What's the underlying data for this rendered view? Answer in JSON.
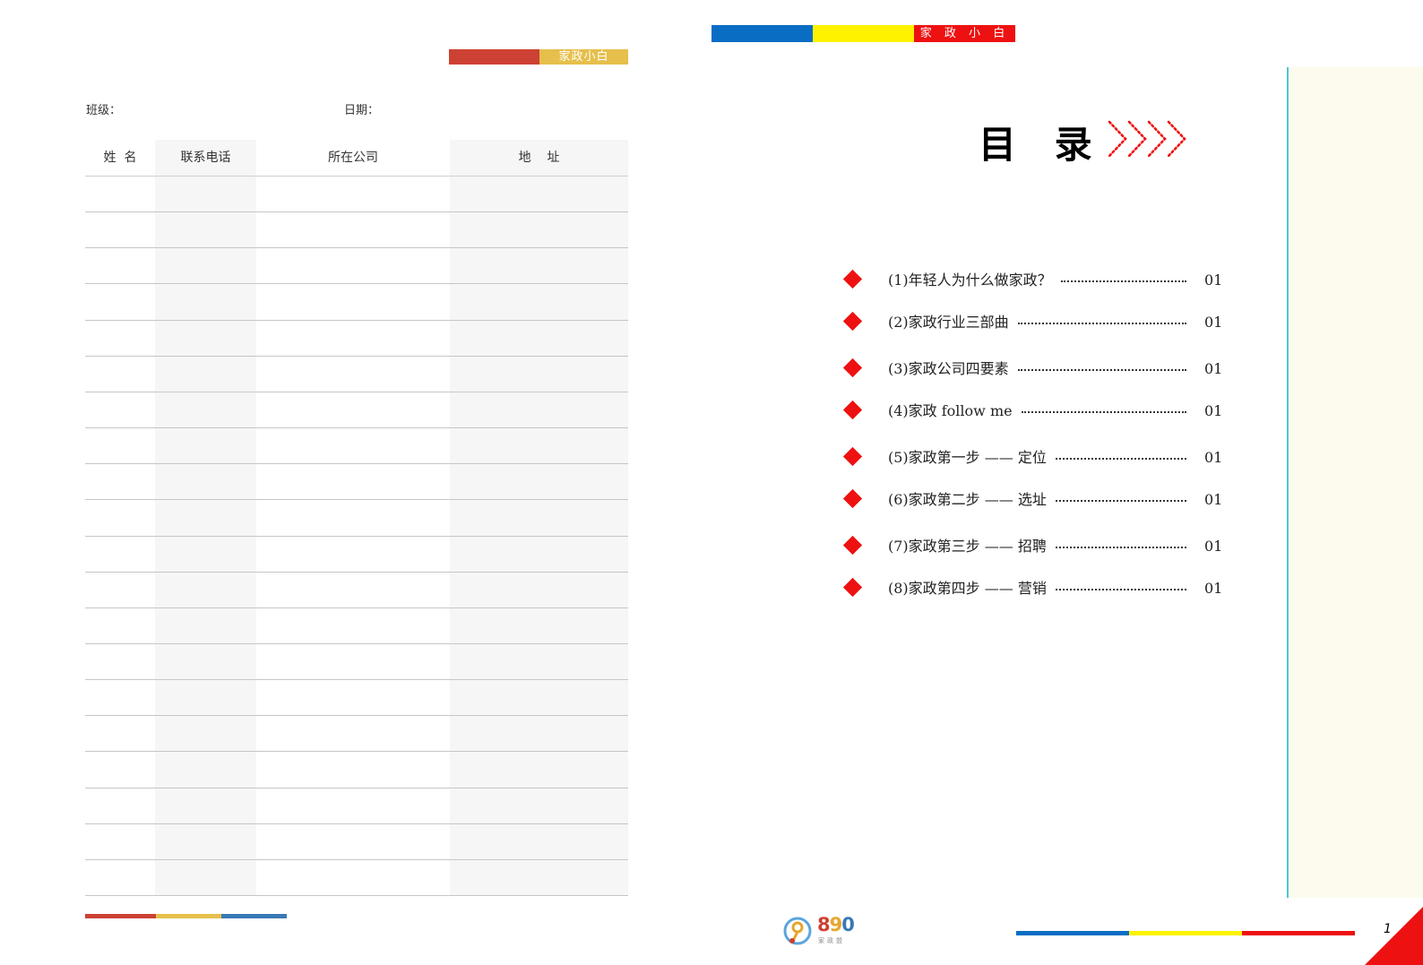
{
  "left_page": {
    "brand_tag": "家政小白",
    "class_label": "班级：",
    "date_label": "日期：",
    "table": {
      "columns": [
        "姓  名",
        "联系电话",
        "所在公司",
        "地    址"
      ],
      "empty_rows": 20
    },
    "colors": {
      "red": "#cc4133",
      "yellow": "#e6bf4c",
      "blue": "#3979b6"
    }
  },
  "right_page": {
    "brand_tag": "家 政 小 白",
    "title": "目 录",
    "toc": [
      {
        "label": "(1)年轻人为什么做家政？",
        "page": "01"
      },
      {
        "label": "(2)家政行业三部曲",
        "page": "01"
      },
      {
        "label": "(3)家政公司四要素",
        "page": "01"
      },
      {
        "label": "(4)家政 follow me",
        "page": "01"
      },
      {
        "label": "(5)家政第一步 —— 定位",
        "page": "01"
      },
      {
        "label": "(6)家政第二步 —— 选址",
        "page": "01"
      },
      {
        "label": "(7)家政第三步 —— 招聘",
        "page": "01"
      },
      {
        "label": "(8)家政第四步 —— 营销",
        "page": "01"
      }
    ],
    "logo_text": "890",
    "logo_sub": "家政盟",
    "page_number": "1",
    "colors": {
      "blue": "#0a6dc4",
      "yellow": "#fff200",
      "red": "#ee1111",
      "teal": "#53c3cf",
      "cream": "#fdfbee"
    }
  }
}
